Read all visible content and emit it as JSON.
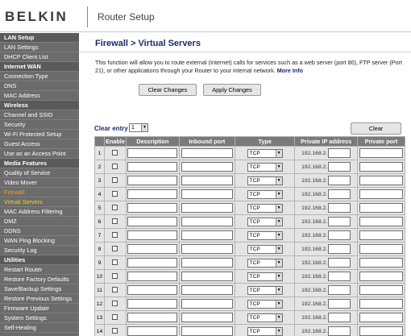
{
  "header": {
    "logo": "BELKIN",
    "title": "Router Setup"
  },
  "sidebar": {
    "items": [
      {
        "label": "LAN Setup",
        "kind": "heading"
      },
      {
        "label": "LAN Settings",
        "kind": "link"
      },
      {
        "label": "DHCP Client List",
        "kind": "link"
      },
      {
        "label": "Internet WAN",
        "kind": "heading"
      },
      {
        "label": "Connection Type",
        "kind": "link"
      },
      {
        "label": "DNS",
        "kind": "link"
      },
      {
        "label": "MAC Address",
        "kind": "link"
      },
      {
        "label": "Wireless",
        "kind": "heading"
      },
      {
        "label": "Channel and SSID",
        "kind": "link"
      },
      {
        "label": "Security",
        "kind": "link"
      },
      {
        "label": "Wi-Fi Protected Setup",
        "kind": "link"
      },
      {
        "label": "Guest Access",
        "kind": "link"
      },
      {
        "label": "Use as an Access Point",
        "kind": "link"
      },
      {
        "label": "Media Features",
        "kind": "heading"
      },
      {
        "label": "Quality of Service",
        "kind": "link"
      },
      {
        "label": "Video Mover",
        "kind": "link"
      },
      {
        "label": "Firewall",
        "kind": "active-section"
      },
      {
        "label": "Virtual Servers",
        "kind": "current"
      },
      {
        "label": "MAC Address Filtering",
        "kind": "link"
      },
      {
        "label": "DMZ",
        "kind": "link"
      },
      {
        "label": "DDNS",
        "kind": "link"
      },
      {
        "label": "WAN Ping Blocking",
        "kind": "link"
      },
      {
        "label": "Security Log",
        "kind": "link"
      },
      {
        "label": "Utilities",
        "kind": "heading"
      },
      {
        "label": "Restart Router",
        "kind": "link"
      },
      {
        "label": "Restore Factory Defaults",
        "kind": "link"
      },
      {
        "label": "Save/Backup Settings",
        "kind": "link"
      },
      {
        "label": "Restore Previous Settings",
        "kind": "link"
      },
      {
        "label": "Firmware Update",
        "kind": "link"
      },
      {
        "label": "System Settings",
        "kind": "link"
      },
      {
        "label": "Self-Healing",
        "kind": "link"
      }
    ]
  },
  "main": {
    "title": "Firewall > Virtual Servers",
    "description": "This function will allow you to route external (Internet) calls for services such as a web server (port 80), FTP server (Port 21), or other applications through your Router to your internal network.",
    "more_info": "More Info",
    "clear_changes_label": "Clear Changes",
    "apply_changes_label": "Apply Changes",
    "clear_entry_label": "Clear entry",
    "clear_entry_value": "1",
    "clear_label": "Clear",
    "table": {
      "headers": [
        "",
        "Enable",
        "Description",
        "Inbound port",
        "Type",
        "Private IP address",
        "Private port"
      ],
      "rows": [
        {
          "num": "1",
          "type": "TCP",
          "ip_prefix": "192.168.2."
        },
        {
          "num": "2",
          "type": "TCP",
          "ip_prefix": "192.168.2."
        },
        {
          "num": "3",
          "type": "TCP",
          "ip_prefix": "192.168.2."
        },
        {
          "num": "4",
          "type": "TCP",
          "ip_prefix": "192.168.2."
        },
        {
          "num": "5",
          "type": "TCP",
          "ip_prefix": "192.168.2."
        },
        {
          "num": "6",
          "type": "TCP",
          "ip_prefix": "192.168.2."
        },
        {
          "num": "7",
          "type": "TCP",
          "ip_prefix": "192.168.2."
        },
        {
          "num": "8",
          "type": "TCP",
          "ip_prefix": "192.168.2."
        },
        {
          "num": "9",
          "type": "TCP",
          "ip_prefix": "192.168.2."
        },
        {
          "num": "10",
          "type": "TCP",
          "ip_prefix": "192.168.2."
        },
        {
          "num": "11",
          "type": "TCP",
          "ip_prefix": "192.168.2."
        },
        {
          "num": "12",
          "type": "TCP",
          "ip_prefix": "192.168.2."
        },
        {
          "num": "13",
          "type": "TCP",
          "ip_prefix": "192.168.2."
        },
        {
          "num": "14",
          "type": "TCP",
          "ip_prefix": "192.168.2."
        }
      ]
    }
  },
  "colors": {
    "sidebar_bg": "#6b6b6b",
    "active_section": "#ff9c1a",
    "current_item": "#ffd400",
    "title_color": "#1d2a6b",
    "table_header_bg": "#7a7a7a"
  }
}
